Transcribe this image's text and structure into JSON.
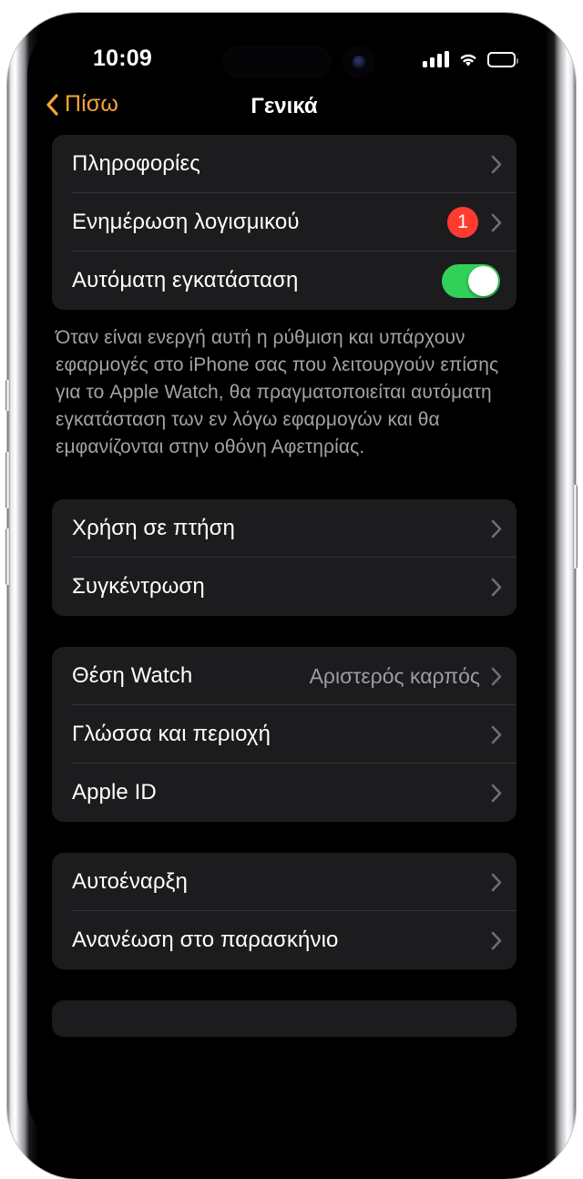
{
  "status_bar": {
    "time": "10:09",
    "cellular_icon": "cellular-bars-icon",
    "wifi_icon": "wifi-icon",
    "battery_icon": "battery-icon"
  },
  "nav": {
    "back_label": "Πίσω",
    "back_icon": "chevron-left-icon",
    "title": "Γενικά"
  },
  "colors": {
    "accent": "#F2A33C",
    "badge_red": "#FF3B2F",
    "toggle_green": "#31D158",
    "card": "#1C1C1E",
    "background": "#000000",
    "secondary_text": "#9D9DA2"
  },
  "groups": [
    {
      "rows": [
        {
          "label": "Πληροφορίες",
          "accessory": "chevron"
        },
        {
          "label": "Ενημέρωση λογισμικού",
          "badge": "1",
          "accessory": "chevron"
        },
        {
          "label": "Αυτόματη εγκατάσταση",
          "accessory": "toggle",
          "toggle_on": true
        }
      ],
      "footer": "Όταν είναι ενεργή αυτή η ρύθμιση και υπάρχουν εφαρμογές στο iPhone σας που λειτουργούν επίσης για το Apple Watch, θα πραγματοποιείται αυτόματη εγκατάσταση των εν λόγω εφαρμογών και θα εμφανίζονται στην οθόνη Αφετηρίας."
    },
    {
      "rows": [
        {
          "label": "Χρήση σε πτήση",
          "accessory": "chevron"
        },
        {
          "label": "Συγκέντρωση",
          "accessory": "chevron"
        }
      ]
    },
    {
      "rows": [
        {
          "label": "Θέση Watch",
          "value": "Αριστερός καρπός",
          "accessory": "chevron"
        },
        {
          "label": "Γλώσσα και περιοχή",
          "accessory": "chevron"
        },
        {
          "label": "Apple ID",
          "accessory": "chevron"
        }
      ]
    },
    {
      "rows": [
        {
          "label": "Αυτοέναρξη",
          "accessory": "chevron"
        },
        {
          "label": "Ανανέωση στο παρασκήνιο",
          "accessory": "chevron"
        }
      ]
    }
  ]
}
